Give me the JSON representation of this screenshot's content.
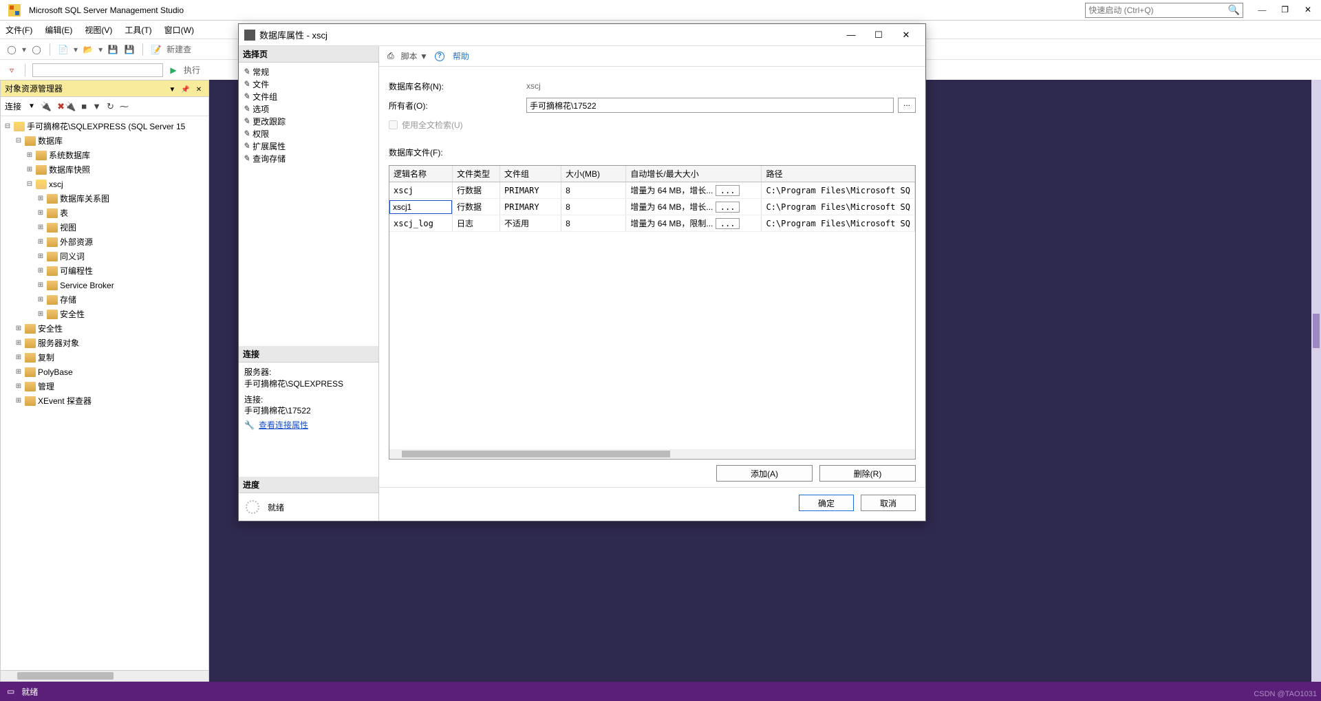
{
  "app": {
    "title": "Microsoft SQL Server Management Studio",
    "quick_launch_placeholder": "快速启动 (Ctrl+Q)"
  },
  "menu": {
    "file": "文件(F)",
    "edit": "编辑(E)",
    "view": "视图(V)",
    "tools": "工具(T)",
    "window": "窗口(W)"
  },
  "toolbar": {
    "new_query": "新建查",
    "execute": "执行"
  },
  "object_explorer": {
    "title": "对象资源管理器",
    "connect_label": "连接",
    "root": "手可摘棉花\\SQLEXPRESS (SQL Server 15",
    "nodes": {
      "databases": "数据库",
      "system_dbs": "系统数据库",
      "db_snapshot": "数据库快照",
      "xscj": "xscj",
      "diagrams": "数据库关系图",
      "tables": "表",
      "views": "视图",
      "external": "外部资源",
      "synonyms": "同义词",
      "programmability": "可编程性",
      "service_broker": "Service Broker",
      "storage": "存储",
      "security_inner": "安全性",
      "security": "安全性",
      "server_objects": "服务器对象",
      "replication": "复制",
      "polybase": "PolyBase",
      "management": "管理",
      "xevent": "XEvent 探查器"
    }
  },
  "dialog": {
    "title": "数据库属性 - xscj",
    "select_page": "选择页",
    "pages": {
      "general": "常规",
      "files": "文件",
      "filegroups": "文件组",
      "options": "选项",
      "change_tracking": "更改跟踪",
      "permissions": "权限",
      "extended": "扩展属性",
      "query_store": "查询存储"
    },
    "connection_header": "连接",
    "connection": {
      "server_lbl": "服务器:",
      "server": "手可摘棉花\\SQLEXPRESS",
      "conn_lbl": "连接:",
      "conn": "手可摘棉花\\17522",
      "view_props": "查看连接属性"
    },
    "progress_header": "进度",
    "progress_status": "就绪",
    "right_toolbar": {
      "script": "脚本",
      "help": "帮助"
    },
    "form": {
      "db_name_lbl": "数据库名称(N):",
      "db_name": "xscj",
      "owner_lbl": "所有者(O):",
      "owner": "手可摘棉花\\17522",
      "fulltext_lbl": "使用全文检索(U)",
      "files_lbl": "数据库文件(F):"
    },
    "grid": {
      "headers": {
        "logical": "逻辑名称",
        "type": "文件类型",
        "group": "文件组",
        "size": "大小(MB)",
        "autogrow": "自动增长/最大大小",
        "path": "路径"
      },
      "rows": [
        {
          "logical": "xscj",
          "type": "行数据",
          "group": "PRIMARY",
          "size": "8",
          "autogrow": "增量为 64 MB，增长...",
          "path": "C:\\Program Files\\Microsoft SQ"
        },
        {
          "logical": "xscj1",
          "type": "行数据",
          "group": "PRIMARY",
          "size": "8",
          "autogrow": "增量为 64 MB，增长...",
          "path": "C:\\Program Files\\Microsoft SQ"
        },
        {
          "logical": "xscj_log",
          "type": "日志",
          "group": "不适用",
          "size": "8",
          "autogrow": "增量为 64 MB，限制...",
          "path": "C:\\Program Files\\Microsoft SQ"
        }
      ]
    },
    "actions": {
      "add": "添加(A)",
      "remove": "删除(R)"
    },
    "footer": {
      "ok": "确定",
      "cancel": "取消"
    }
  },
  "status": {
    "ready": "就绪"
  },
  "watermark": "CSDN @TAO1031"
}
